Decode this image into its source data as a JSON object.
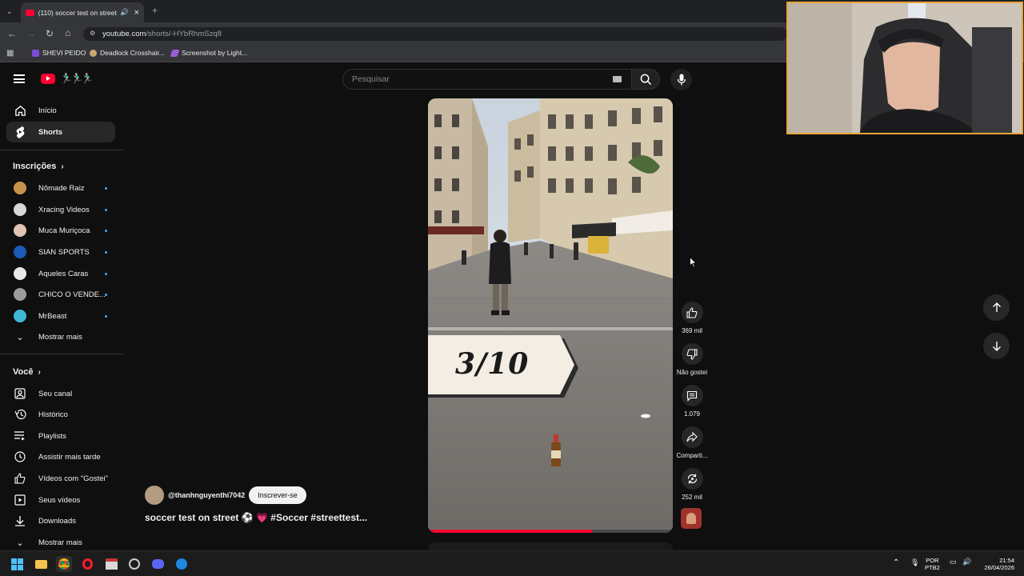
{
  "browser": {
    "tab_title": "(110) soccer test on street",
    "url_domain": "youtube.com",
    "url_path": "/shorts/-HYbRhmSzq8",
    "bookmarks": [
      "SHEVI PEIDO",
      "Deadlock Crosshair...",
      "Screenshot by Light..."
    ]
  },
  "youtube": {
    "logo_emoji": "🏃🏻‍♂️🏃🏻‍♂️🏃🏻‍♂️",
    "search_placeholder": "Pesquisar",
    "nav": [
      {
        "label": "Início"
      },
      {
        "label": "Shorts"
      }
    ],
    "subscriptions_title": "Inscrições",
    "subscriptions": [
      {
        "label": "Nômade Raiz",
        "color": "#c9924a"
      },
      {
        "label": "Xracing Videos",
        "color": "#d8d8d8"
      },
      {
        "label": "Muca Muriçoca",
        "color": "#e2c4b4"
      },
      {
        "label": "SIAN SPORTS",
        "color": "#1a5bb8"
      },
      {
        "label": "Aqueles Caras",
        "color": "#e8e8e8"
      },
      {
        "label": "CHICO O VENDE...",
        "color": "#9b9b9b"
      },
      {
        "label": "MrBeast",
        "color": "#3fb8d6"
      }
    ],
    "show_more_1": "Mostrar mais",
    "you_title": "Você",
    "you_items": [
      {
        "label": "Seu canal"
      },
      {
        "label": "Histórico"
      },
      {
        "label": "Playlists"
      },
      {
        "label": "Assistir mais tarde"
      },
      {
        "label": "Vídeos com \"Gostei\""
      },
      {
        "label": "Seus vídeos"
      },
      {
        "label": "Downloads"
      }
    ],
    "show_more_2": "Mostrar mais",
    "short": {
      "overlay_score": "3/10",
      "channel": "@thanhnguyenthi7042",
      "subscribe_label": "Inscrever-se",
      "title": "soccer test on street ⚽ 💗 #Soccer #streettest...",
      "likes": "369 mil",
      "dislike_label": "Não gostei",
      "comments": "1.079",
      "share_label": "Comparti...",
      "remix": "252 mil"
    }
  },
  "taskbar": {
    "lang_top": "POR",
    "lang_bottom": "PTB2",
    "time": "21:54",
    "date": "26/04/2026"
  },
  "colors": {
    "accent_red": "#ff0033",
    "link_blue": "#3ea6ff",
    "webcam_border": "#e8a53b"
  }
}
